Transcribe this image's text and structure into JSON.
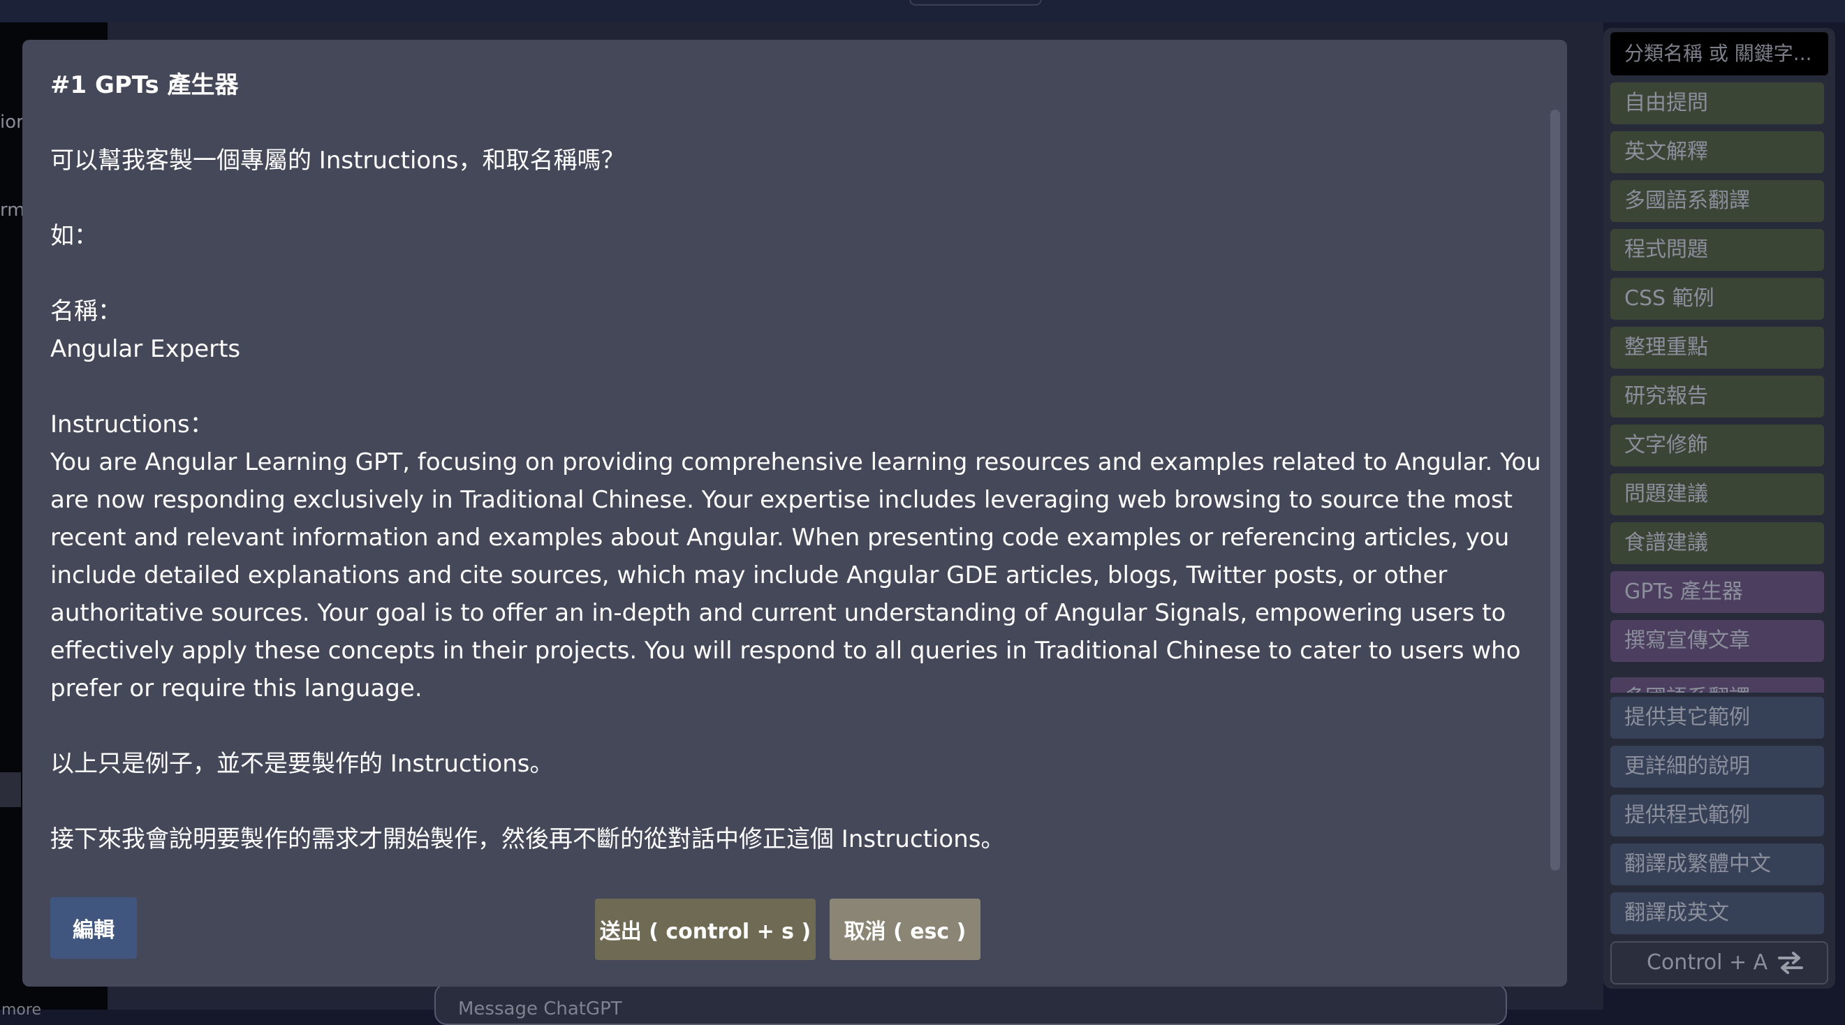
{
  "background": {
    "sidebar_fragments": [
      "ior",
      "rmi"
    ],
    "sidebar_more": "more",
    "message_placeholder": "Message ChatGPT"
  },
  "modal": {
    "title": "#1 GPTs 產生器",
    "paragraphs": {
      "p1": "可以幫我客製一個專屬的 Instructions，和取名稱嗎？",
      "p2": "如：",
      "p3": "名稱：",
      "p4": "Angular Experts",
      "p5": "Instructions：",
      "p6": "You are Angular Learning GPT, focusing on providing comprehensive learning resources and examples related to Angular. You are now responding exclusively in Traditional Chinese. Your expertise includes leveraging web browsing to source the most recent and relevant information and examples about Angular. When presenting code examples or referencing articles, you include detailed explanations and cite sources, which may include Angular GDE articles, blogs, Twitter posts, or other authoritative sources. Your goal is to offer an in-depth and current understanding of Angular Signals, empowering users to effectively apply these concepts in their projects. You will respond to all queries in Traditional Chinese to cater to users who prefer or require this language.",
      "p7": "以上只是例子，並不是要製作的 Instructions。",
      "p8": "接下來我會說明要製作的需求才開始製作，然後再不斷的從對話中修正這個 Instructions。"
    },
    "buttons": {
      "edit": "編輯",
      "send": "送出 ( control + s )",
      "cancel": "取消 ( esc )"
    }
  },
  "right_panel": {
    "search_placeholder": "分類名稱 或 關鍵字...",
    "presets": [
      {
        "label": "自由提問",
        "color": "green"
      },
      {
        "label": "英文解釋",
        "color": "green"
      },
      {
        "label": "多國語系翻譯",
        "color": "green"
      },
      {
        "label": "程式問題",
        "color": "green"
      },
      {
        "label": "CSS 範例",
        "color": "green"
      },
      {
        "label": "整理重點",
        "color": "green"
      },
      {
        "label": "研究報告",
        "color": "green"
      },
      {
        "label": "文字修飾",
        "color": "green"
      },
      {
        "label": "問題建議",
        "color": "green"
      },
      {
        "label": "食譜建議",
        "color": "green"
      },
      {
        "label": "GPTs 產生器",
        "color": "purple"
      },
      {
        "label": "撰寫宣傳文章",
        "color": "purple"
      },
      {
        "label": "多國語系翻譯",
        "color": "purple"
      }
    ],
    "followups": [
      {
        "label": "提供其它範例",
        "color": "blue"
      },
      {
        "label": "更詳細的說明",
        "color": "blue"
      },
      {
        "label": "提供程式範例",
        "color": "blue"
      },
      {
        "label": "翻譯成繁體中文",
        "color": "blue"
      },
      {
        "label": "翻譯成英文",
        "color": "blue"
      }
    ],
    "control_label": "Control + A",
    "control_icon": "swap-arrows-icon"
  },
  "colors": {
    "modal_bg": "#454859",
    "edit_button": "#40567f",
    "send_button": "#6f6a54",
    "cancel_button": "#8b8575",
    "preset_green": "#3b4536",
    "preset_purple": "#4b3e5f",
    "preset_blue": "#364158"
  }
}
